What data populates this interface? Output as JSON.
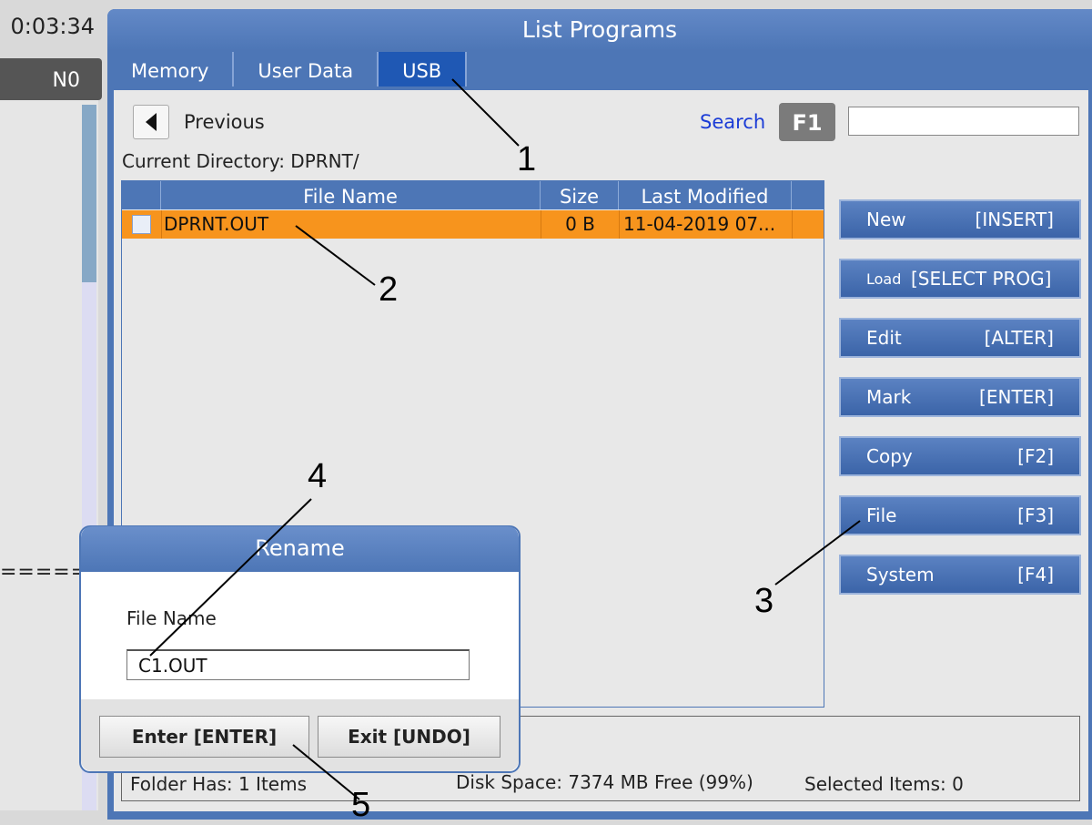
{
  "status": {
    "clock": "0:03:34",
    "line_number": "N0",
    "separator": "======"
  },
  "window": {
    "title": "List Programs",
    "tabs": [
      {
        "label": "Memory"
      },
      {
        "label": "User Data"
      },
      {
        "label": "USB",
        "active": true
      }
    ]
  },
  "navigation": {
    "previous_label": "Previous",
    "search_label": "Search",
    "search_key": "F1",
    "search_value": ""
  },
  "directory": {
    "label": "Current Directory: DPRNT/"
  },
  "table": {
    "columns": [
      "",
      "File Name",
      "Size",
      "Last Modified"
    ],
    "rows": [
      {
        "checked": false,
        "name": "DPRNT.OUT",
        "size": "0 B",
        "modified": "11-04-2019 07..."
      }
    ]
  },
  "actions": [
    {
      "label": "New",
      "key": "[INSERT]"
    },
    {
      "label": "Load",
      "key": "[SELECT PROG]"
    },
    {
      "label": "Edit",
      "key": "[ALTER]"
    },
    {
      "label": "Mark",
      "key": "[ENTER]"
    },
    {
      "label": "Copy",
      "key": "[F2]"
    },
    {
      "label": "File",
      "key": "[F3]"
    },
    {
      "label": "System",
      "key": "[F4]"
    }
  ],
  "footer": {
    "folder_count": "Folder Has: 1 Items",
    "disk_space": "Disk Space: 7374 MB Free (99%)",
    "selected": "Selected Items: 0"
  },
  "dialog": {
    "title": "Rename",
    "field_label": "File Name",
    "field_value": "C1.OUT",
    "enter_label": "Enter [ENTER]",
    "exit_label": "Exit [UNDO]"
  },
  "callouts": [
    "1",
    "2",
    "3",
    "4",
    "5"
  ],
  "colors": {
    "window_blue": "#4d76b6",
    "active_tab": "#1f58b4",
    "selected_row": "#f7941d",
    "search_text": "#1a3bd6"
  }
}
